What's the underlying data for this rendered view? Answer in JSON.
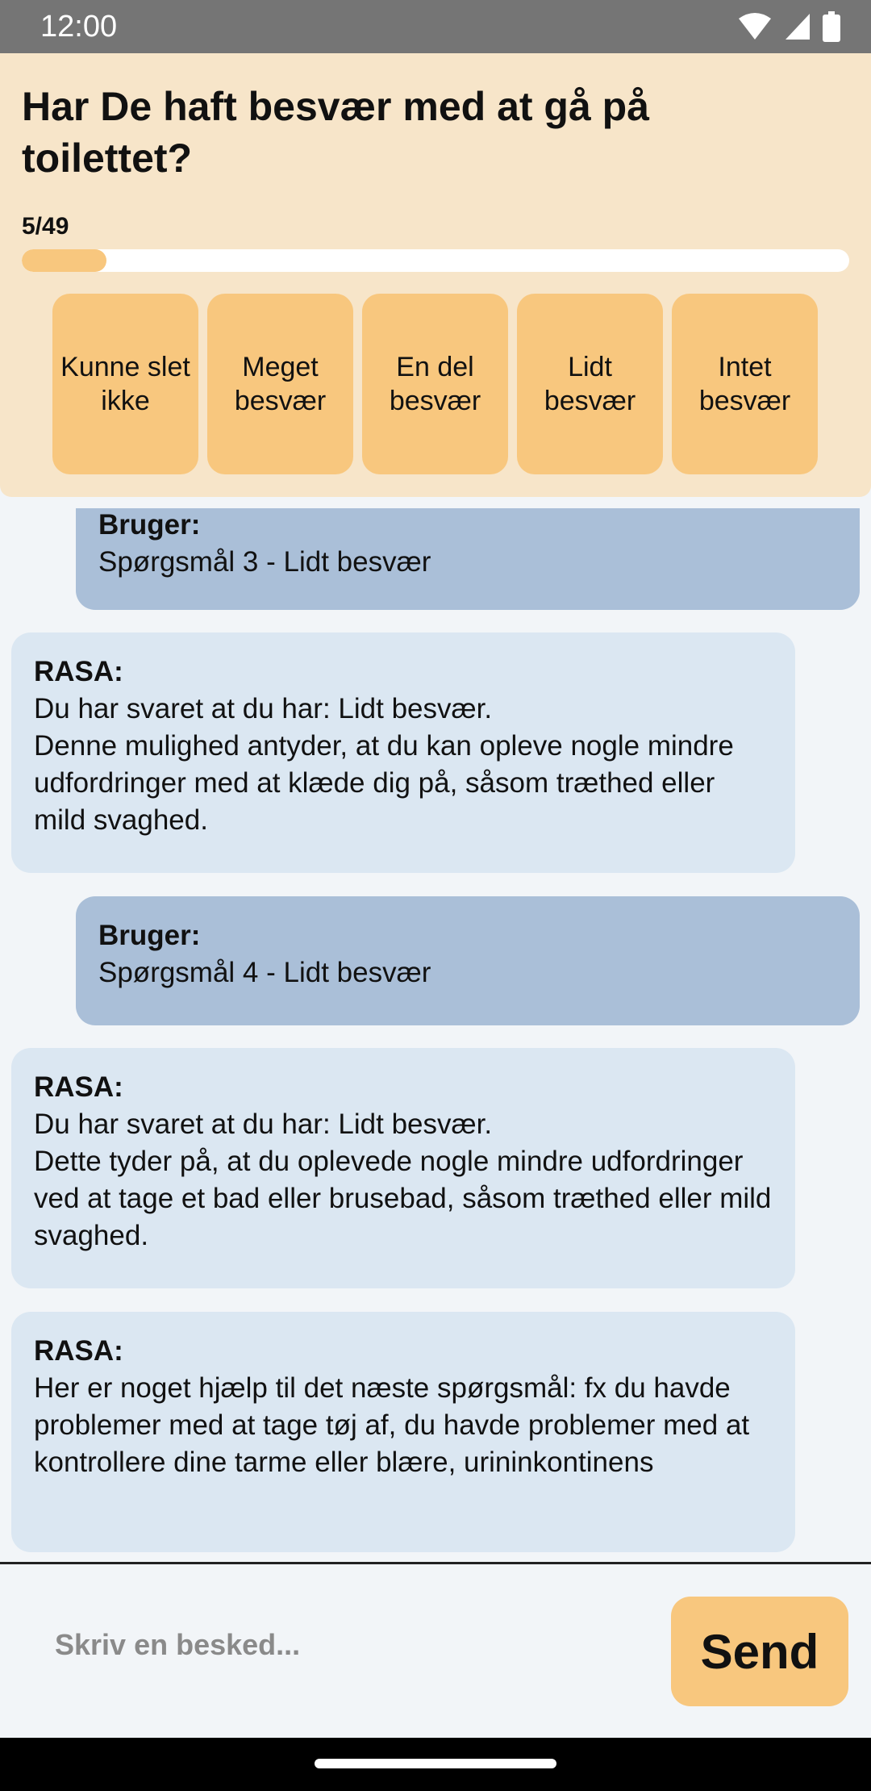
{
  "status_bar": {
    "time": "12:00",
    "icons": [
      "wifi-icon",
      "signal-icon",
      "battery-icon"
    ]
  },
  "question": {
    "title": "Har De haft besvær med at gå på toilettet?",
    "progress_text": "5/49",
    "progress_fraction": 0.102
  },
  "answers": [
    "Kunne slet ikke",
    "Meget besvær",
    "En del besvær",
    "Lidt besvær",
    "Intet besvær"
  ],
  "messages": [
    {
      "role": "user",
      "sender": "Bruger:",
      "text": "Spørgsmål 3 - Lidt besvær"
    },
    {
      "role": "bot",
      "sender": "RASA:",
      "text": "Du har svaret at du har: Lidt besvær.\nDenne mulighed antyder, at du kan opleve nogle mindre udfordringer med at klæde dig på, såsom træthed eller mild svaghed."
    },
    {
      "role": "user",
      "sender": "Bruger:",
      "text": "Spørgsmål 4 - Lidt besvær"
    },
    {
      "role": "bot",
      "sender": "RASA:",
      "text": "Du har svaret at du har: Lidt besvær.\nDette tyder på, at du oplevede nogle mindre udfordringer ved at tage et bad eller brusebad, såsom træthed eller mild svaghed."
    },
    {
      "role": "bot",
      "sender": "RASA:",
      "text": "Her er noget hjælp til det næste spørgsmål: fx du havde problemer med at tage tøj af, du havde problemer med at kontrollere dine tarme eller blære, urininkontinens"
    }
  ],
  "composer": {
    "placeholder": "Skriv en besked...",
    "value": "",
    "send_label": "Send"
  },
  "colors": {
    "header_bg": "#f7e5c9",
    "accent": "#f8c77e",
    "user_bubble": "#aabfd8",
    "bot_bubble": "#dbe7f2",
    "chat_bg": "#f2f5f8"
  }
}
